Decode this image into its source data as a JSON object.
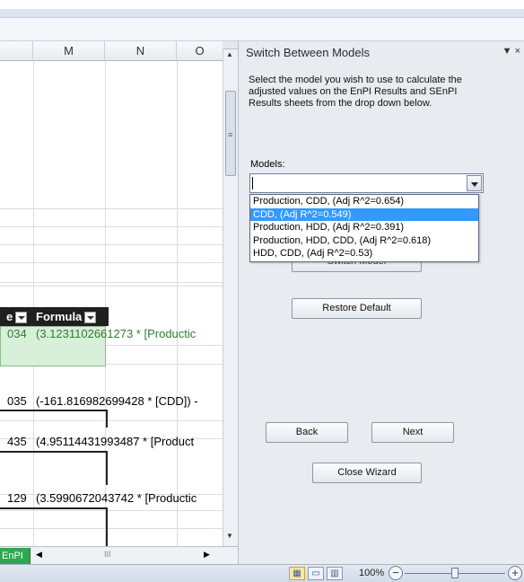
{
  "sheet": {
    "columns": [
      "M",
      "N",
      "O"
    ],
    "header_row": {
      "col1": "e",
      "col2": "Formula"
    },
    "rows": [
      {
        "id": "034",
        "formula": "(3.1231102661273 * [Productic"
      },
      {
        "id": "035",
        "formula": "(-161.816982699428 * [CDD]) -"
      },
      {
        "id": "435",
        "formula": "(4.95114431993487 * [Product"
      },
      {
        "id": "129",
        "formula": "(3.5990672043742 * [Productic"
      }
    ],
    "sheet_tab": "EnPI",
    "scroll_thumb_glyph": "III",
    "grip_glyph": "≡"
  },
  "statusbar": {
    "zoom": "100%",
    "zoom_percent": 100,
    "zoom_out": "−",
    "zoom_in": "+"
  },
  "pane": {
    "title": "Switch Between Models",
    "controls": "▼ ×",
    "instructions": "Select the model you wish to use to calculate the adjusted values on the EnPI Results and SEnPI Results sheets from the drop down below.",
    "models_label": "Models:",
    "models_value": "",
    "options": [
      "Production, CDD, (Adj R^2=0.654)",
      "CDD, (Adj R^2=0.549)",
      "Production, HDD, (Adj R^2=0.391)",
      "Production, HDD, CDD, (Adj R^2=0.618)",
      "HDD, CDD, (Adj R^2=0.53)"
    ],
    "highlighted_option_index": 1,
    "switch_model": "Switch Model",
    "restore_default": "Restore Default",
    "back": "Back",
    "next": "Next",
    "close_wizard": "Close Wizard"
  },
  "colors": {
    "header_fill": "#1f1f1f",
    "formula_text": "#2e7d32",
    "highlight": "#3399ff",
    "green_fill": "#d8efd9",
    "tab_green": "#2fa84f"
  }
}
